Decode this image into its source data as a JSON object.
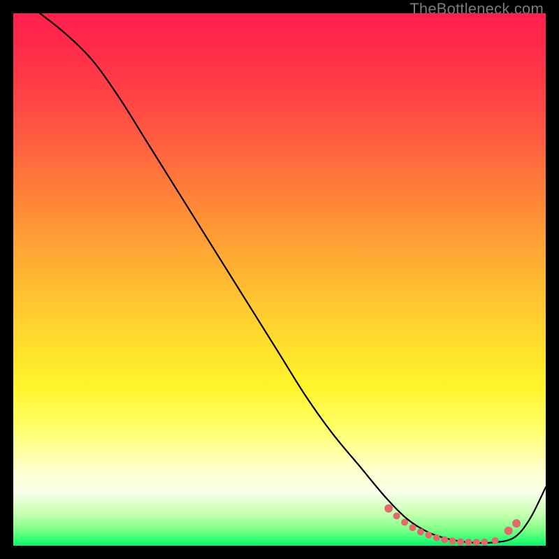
{
  "watermark": "TheBottleneck.com",
  "chart_data": {
    "type": "line",
    "title": "",
    "xlabel": "",
    "ylabel": "",
    "xlim": [
      0,
      100
    ],
    "ylim": [
      0,
      100
    ],
    "series": [
      {
        "name": "curve",
        "x": [
          5,
          10,
          15,
          20,
          25,
          30,
          35,
          40,
          45,
          50,
          55,
          60,
          65,
          70,
          74,
          78,
          82,
          86,
          90,
          94,
          97,
          100
        ],
        "y": [
          100,
          96,
          91,
          84,
          76,
          68,
          60,
          52,
          44,
          36,
          28,
          21,
          15,
          9,
          5,
          2.5,
          1.2,
          0.6,
          0.6,
          1.5,
          5,
          11
        ]
      }
    ],
    "markers": {
      "name": "highlight-dots",
      "color": "#e26a6a",
      "x": [
        70.5,
        72,
        73.5,
        75,
        76.5,
        78,
        79.5,
        81,
        82.5,
        84,
        85.5,
        87,
        88.5,
        90.5,
        93,
        94.5
      ],
      "y": [
        7.0,
        5.6,
        4.4,
        3.4,
        2.6,
        2.0,
        1.5,
        1.15,
        0.9,
        0.75,
        0.68,
        0.66,
        0.7,
        0.95,
        2.8,
        4.2
      ]
    }
  }
}
